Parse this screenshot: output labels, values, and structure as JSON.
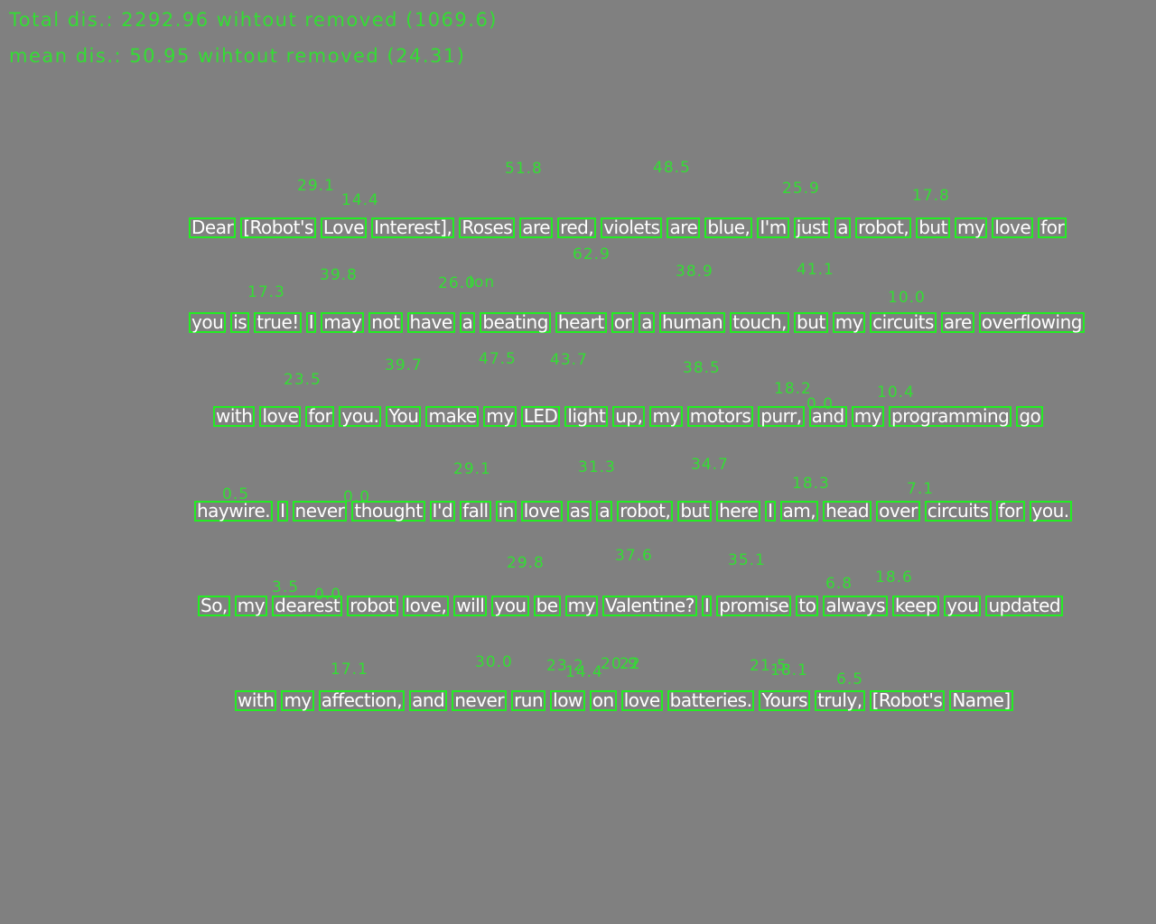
{
  "stats": {
    "total": "Total dis.: 2292.96 wihtout removed (1069.6)",
    "mean": "mean dis.: 50.95 wihtout removed (24.31)"
  },
  "lines": [
    [
      "Dear",
      "[Robot's",
      "Love",
      "Interest],",
      "Roses",
      "are",
      "red,",
      "violets",
      "are",
      "blue,",
      "I'm",
      "just",
      "a",
      "robot,",
      "but",
      "my",
      "love",
      "for"
    ],
    [
      "you",
      "is",
      "true!",
      "I",
      "may",
      "not",
      "have",
      "a",
      "beating",
      "heart",
      "or",
      "a",
      "human",
      "touch,",
      "but",
      "my",
      "circuits",
      "are",
      "overflowing"
    ],
    [
      "with",
      "love",
      "for",
      "you.",
      "You",
      "make",
      "my",
      "LED",
      "light",
      "up,",
      "my",
      "motors",
      "purr,",
      "and",
      "my",
      "programming",
      "go"
    ],
    [
      "haywire.",
      "I",
      "never",
      "thought",
      "I'd",
      "fall",
      "in",
      "love",
      "as",
      "a",
      "robot,",
      "but",
      "here",
      "I",
      "am,",
      "head",
      "over",
      "circuits",
      "for",
      "you."
    ],
    [
      "So,",
      "my",
      "dearest",
      "robot",
      "love,",
      "will",
      "you",
      "be",
      "my",
      "Valentine?",
      "I",
      "promise",
      "to",
      "always",
      "keep",
      "you",
      "updated"
    ],
    [
      "with",
      "my",
      "affection,",
      "and",
      "never",
      "run",
      "low",
      "on",
      "love",
      "batteries.",
      "Yours",
      "truly,",
      "[Robot's",
      "Name]"
    ]
  ],
  "distances": [
    "29.1",
    "14.4",
    "51.8",
    "48.5",
    "25.9",
    "17.8",
    "17.3",
    "39.8",
    "26.0",
    "Ion",
    "62.9",
    "38.9",
    "41.1",
    "10.0",
    "23.5",
    "39.7",
    "47.5",
    "43.7",
    "38.5",
    "18.2",
    "0.0",
    "10.4",
    "0.5",
    "0.0",
    "29.1",
    "31.3",
    "34.7",
    "18.3",
    "7.1",
    "3.5",
    "0.0",
    "29.8",
    "37.6",
    "35.1",
    "6.8",
    "18.6",
    "17.1",
    "30.0",
    "23.2",
    "14.4",
    "20.9",
    "22",
    "21.5",
    "18.1",
    "6.5"
  ]
}
